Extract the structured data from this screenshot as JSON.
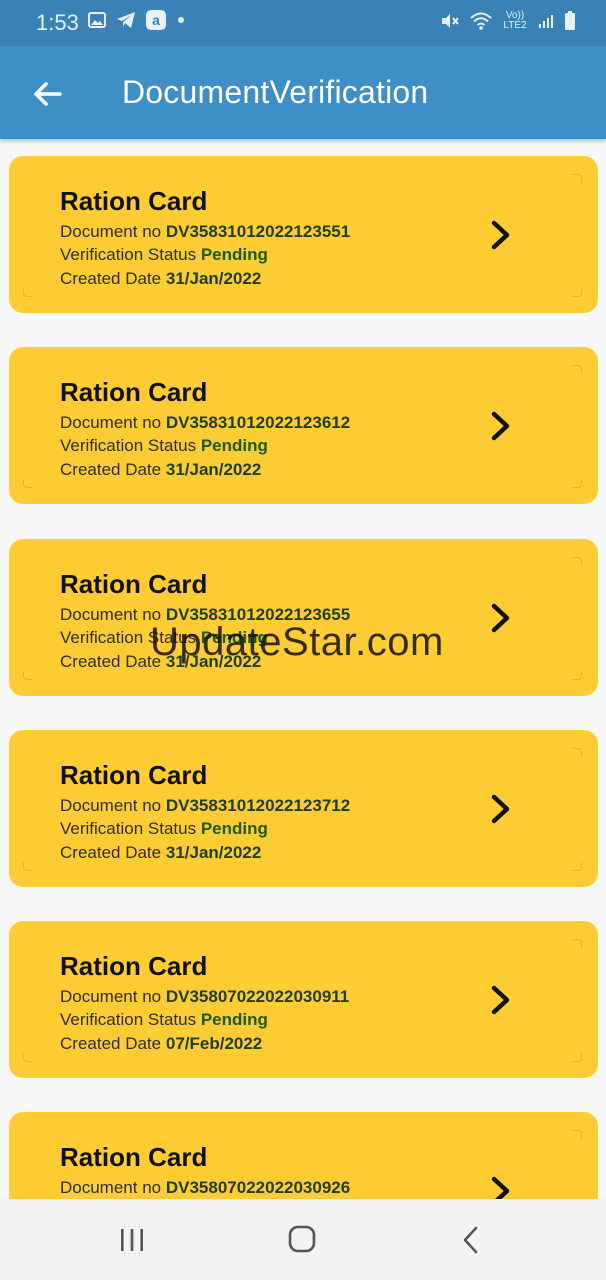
{
  "status_bar": {
    "time": "1:53",
    "left_icons": [
      "image-icon",
      "telegram-icon",
      "a-app-icon",
      "dot-icon"
    ],
    "right_icons": [
      "mute-icon",
      "wifi-icon",
      "volte-lte2-icon",
      "signal-icon",
      "battery-icon"
    ],
    "network_label": "Vo)) LTE2"
  },
  "app_bar": {
    "title": "DocumentVerification",
    "back_icon": "arrow-left-icon",
    "background": "#3d8fc6"
  },
  "labels": {
    "document_no": "Document no",
    "verification_status": "Verification Status",
    "created_date": "Created Date"
  },
  "documents": [
    {
      "title": "Ration Card",
      "document_no": "DV35831012022123551",
      "status": "Pending",
      "created_date": "31/Jan/2022"
    },
    {
      "title": "Ration Card",
      "document_no": "DV35831012022123612",
      "status": "Pending",
      "created_date": "31/Jan/2022"
    },
    {
      "title": "Ration Card",
      "document_no": "DV35831012022123655",
      "status": "Pending",
      "created_date": "31/Jan/2022"
    },
    {
      "title": "Ration Card",
      "document_no": "DV35831012022123712",
      "status": "Pending",
      "created_date": "31/Jan/2022"
    },
    {
      "title": "Ration Card",
      "document_no": "DV35807022022030911",
      "status": "Pending",
      "created_date": "07/Feb/2022"
    },
    {
      "title": "Ration Card",
      "document_no": "DV35807022022030926"
    }
  ],
  "watermark": "UpdateStar.com",
  "nav_bar": {
    "buttons": [
      "recent-apps-icon",
      "home-icon",
      "back-icon"
    ]
  },
  "colors": {
    "card": "#ffcc33",
    "status_bar": "#3a82b5",
    "status_value": "#1a5a1a"
  }
}
